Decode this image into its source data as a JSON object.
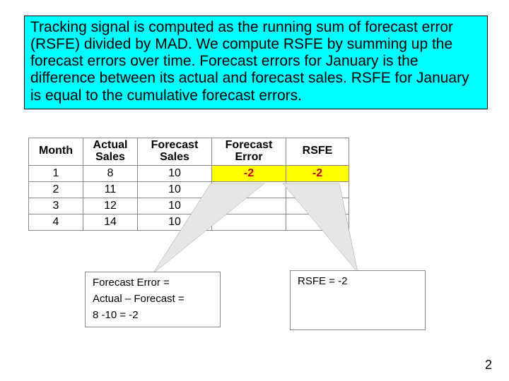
{
  "description": "Tracking signal is computed as the running sum of forecast error (RSFE) divided by MAD.  We compute RSFE by summing up the forecast errors over time.  Forecast errors for January is the difference between its actual and forecast sales.  RSFE for January is equal to the cumulative forecast errors.",
  "table": {
    "headers": {
      "month": "Month",
      "actual": "Actual Sales",
      "forecast": "Forecast Sales",
      "error": "Forecast Error",
      "rsfe": "RSFE"
    },
    "rows": [
      {
        "month": "1",
        "actual": "8",
        "forecast": "10",
        "error": "-2",
        "rsfe": "-2",
        "highlight": true
      },
      {
        "month": "2",
        "actual": "11",
        "forecast": "10",
        "error": "",
        "rsfe": ""
      },
      {
        "month": "3",
        "actual": "12",
        "forecast": "10",
        "error": "",
        "rsfe": ""
      },
      {
        "month": "4",
        "actual": "14",
        "forecast": "10",
        "error": "",
        "rsfe": ""
      }
    ]
  },
  "callout_left": {
    "line1": "Forecast Error =",
    "line2": "Actual – Forecast =",
    "line3": "8 -10 = -2"
  },
  "callout_right": {
    "line1": "RSFE =  -2"
  },
  "page_number": "2"
}
